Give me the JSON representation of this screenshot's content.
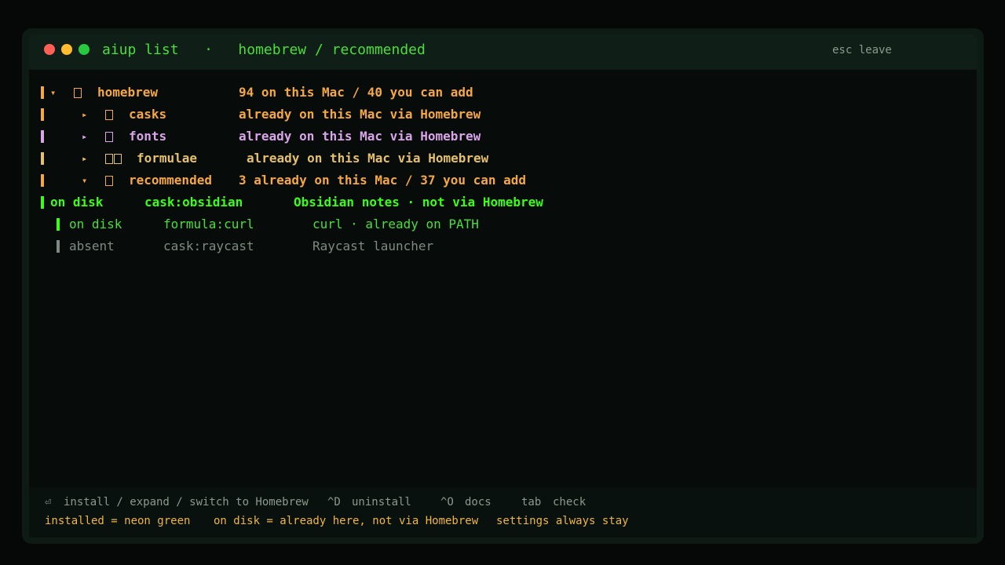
{
  "window": {
    "title": "aiup list",
    "separator": "·",
    "path": "homebrew / recommended",
    "esc_hint": "esc leave"
  },
  "tree": {
    "homebrew": {
      "toggle": "▾",
      "label": "homebrew",
      "detail": "94 on this Mac / 40 you can add"
    },
    "casks": {
      "toggle": "▸",
      "label": "casks",
      "detail": "already on this Mac via Homebrew"
    },
    "fonts": {
      "toggle": "▸",
      "label": "fonts",
      "detail": "already on this Mac via Homebrew"
    },
    "formulae": {
      "toggle": "▸",
      "label": "formulae",
      "detail": "already on this Mac via Homebrew"
    },
    "recommended": {
      "toggle": "▾",
      "label": "recommended",
      "detail": "3 already on this Mac / 37 you can add"
    }
  },
  "items": [
    {
      "status": "on disk",
      "id": "cask:obsidian",
      "desc": "Obsidian notes · not via Homebrew"
    },
    {
      "status": "on disk",
      "id": "formula:curl",
      "desc": "curl · already on PATH"
    },
    {
      "status": "absent",
      "id": "cask:raycast",
      "desc": "Raycast launcher"
    }
  ],
  "footer": {
    "enter_key": "⏎",
    "enter_action": "install / expand / switch to Homebrew",
    "uninstall_key": "^D",
    "uninstall_action": "uninstall",
    "docs_key": "^O",
    "docs_action": "docs",
    "tab_key": "tab",
    "tab_action": "check",
    "legend_installed": "installed = neon green",
    "legend_on_disk": "on disk = already here, not via Homebrew",
    "legend_settings": "settings always stay"
  },
  "colors": {
    "neon": "#39ff14",
    "orange": "#f5a742",
    "pink": "#d9a4e8",
    "tan": "#e5c06a",
    "grey": "#7e8a82"
  }
}
